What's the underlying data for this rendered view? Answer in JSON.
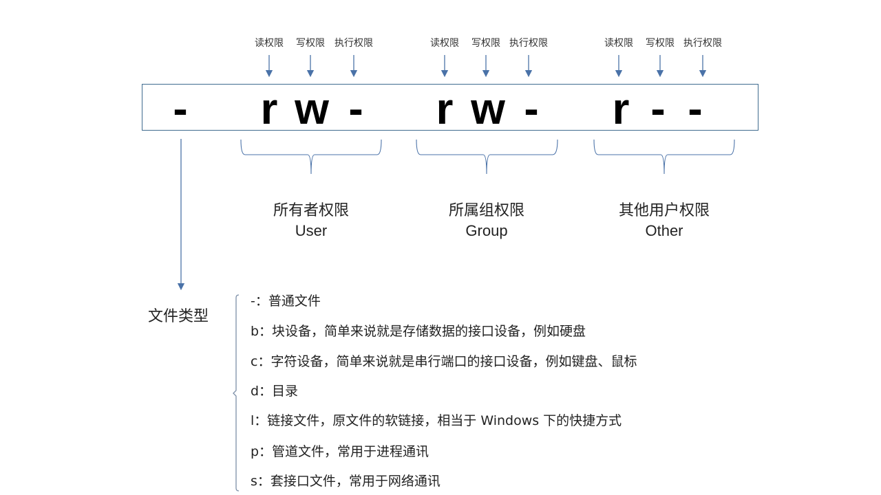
{
  "permission_string": {
    "type_char": "-",
    "user": [
      "r",
      "w",
      "-"
    ],
    "group": [
      "r",
      "w",
      "-"
    ],
    "other": [
      "r",
      "-",
      "-"
    ]
  },
  "bit_labels": {
    "user": [
      "读权限",
      "写权限",
      "执行权限"
    ],
    "group": [
      "读权限",
      "写权限",
      "执行权限"
    ],
    "other": [
      "读权限",
      "写权限",
      "执行权限"
    ]
  },
  "groups": [
    {
      "title": "所有者权限",
      "subtitle": "User"
    },
    {
      "title": "所属组权限",
      "subtitle": "Group"
    },
    {
      "title": "其他用户权限",
      "subtitle": "Other"
    }
  ],
  "file_type": {
    "label": "文件类型",
    "items": [
      "-：普通文件",
      "b：块设备，简单来说就是存储数据的接口设备，例如硬盘",
      "c：字符设备，简单来说就是串行端口的接口设备，例如键盘、鼠标",
      "d：目录",
      "l：链接文件，原文件的软链接，相当于 Windows 下的快捷方式",
      "p：管道文件，常用于进程通讯",
      "s：套接口文件，常用于网络通讯"
    ]
  },
  "colors": {
    "line": "#4a72a8",
    "box_border": "#3e6a8e",
    "brace": "#7d8fa8"
  }
}
